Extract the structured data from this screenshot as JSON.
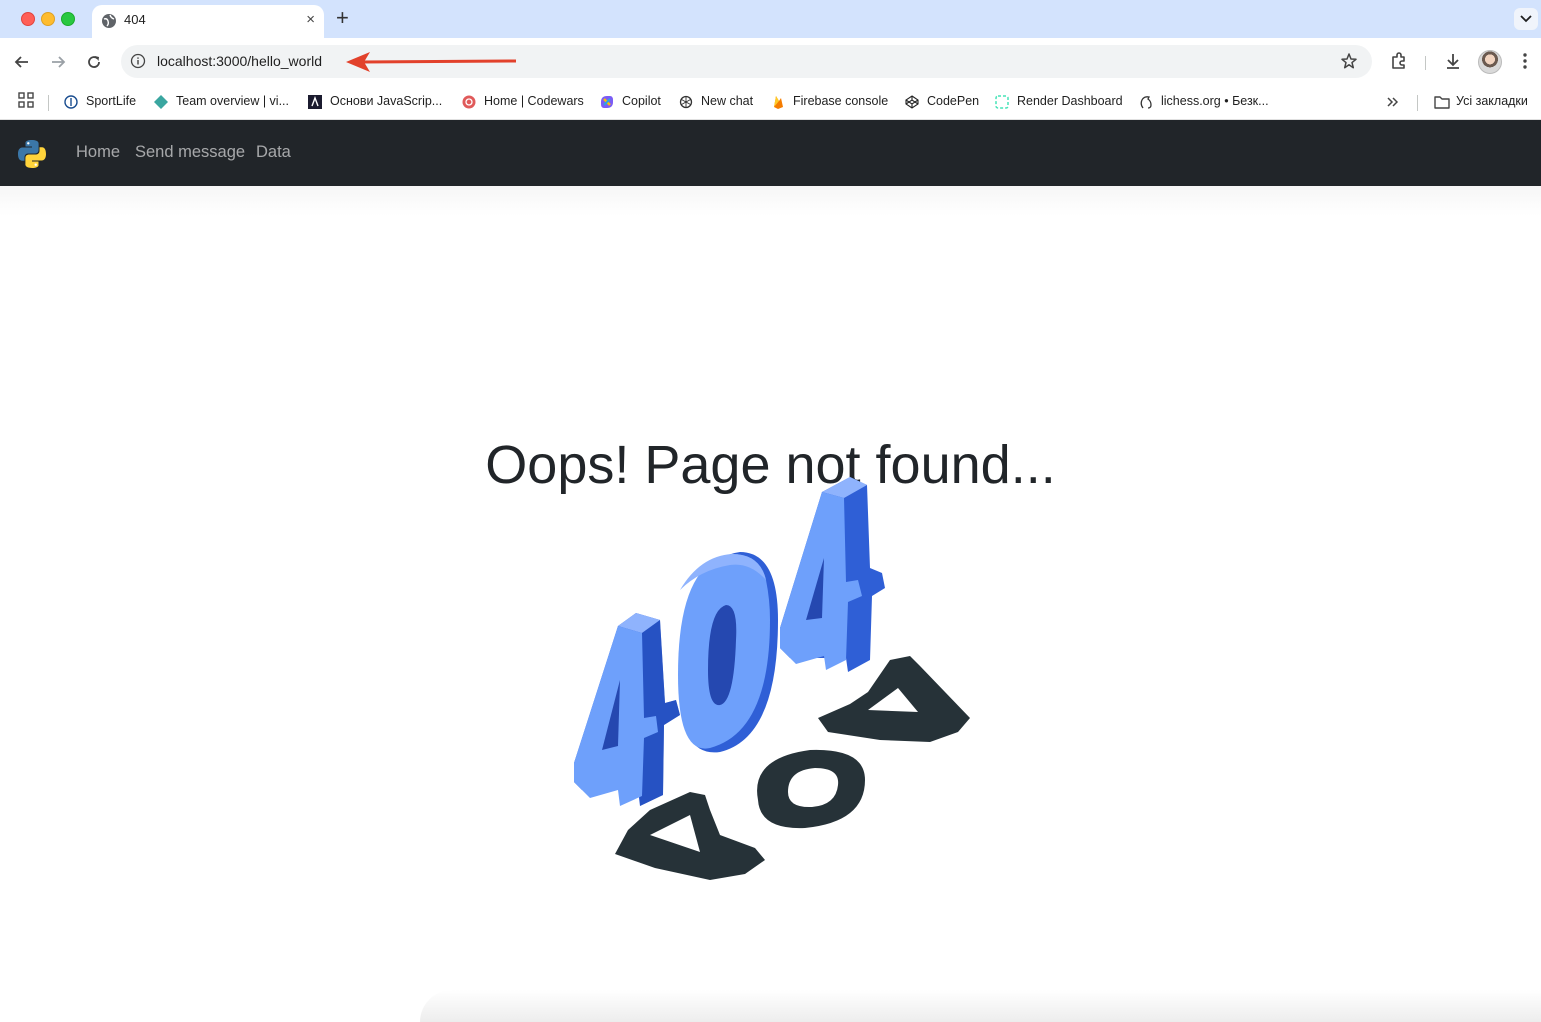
{
  "browser": {
    "tab_title": "404",
    "url": "localhost:3000/hello_world",
    "new_tab_label": "+",
    "tab_close_label": "×"
  },
  "bookmarks": [
    {
      "label": "SportLife",
      "icon": "sportlife-icon"
    },
    {
      "label": "Team overview | vi...",
      "icon": "diamond-icon"
    },
    {
      "label": "Основи JavaScrip...",
      "icon": "lambda-icon"
    },
    {
      "label": "Home | Codewars",
      "icon": "codewars-icon"
    },
    {
      "label": "Copilot",
      "icon": "copilot-icon"
    },
    {
      "label": "New chat",
      "icon": "openai-icon"
    },
    {
      "label": "Firebase console",
      "icon": "firebase-icon"
    },
    {
      "label": "CodePen",
      "icon": "codepen-icon"
    },
    {
      "label": "Render Dashboard",
      "icon": "render-icon"
    },
    {
      "label": "lichess.org • Безк...",
      "icon": "lichess-icon"
    }
  ],
  "all_bookmarks_label": "Усі закладки",
  "site": {
    "nav": [
      {
        "label": "Home"
      },
      {
        "label": "Send message"
      },
      {
        "label": "Data"
      }
    ],
    "heading": "Oops! Page not found...",
    "illustration_text": "404",
    "colors": {
      "navbar": "#212529",
      "digit_light": "#6ea0fb",
      "digit_dark": "#2f5fd6",
      "shadow": "#263238"
    }
  }
}
